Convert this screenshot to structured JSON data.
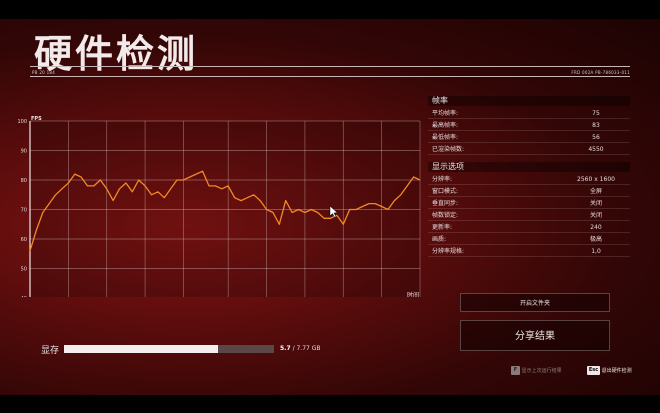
{
  "title": "硬件检测",
  "header": {
    "left_code": "PB 20 184",
    "right_code": "FRD 002A PB-786033-011"
  },
  "chart_data": {
    "type": "line",
    "ylabel": "FPS",
    "xlabel": "时间",
    "ylim": [
      40,
      100
    ],
    "yticks": [
      40,
      50,
      60,
      70,
      80,
      90,
      100
    ],
    "xlim": [
      0,
      61
    ],
    "xticks": [
      0,
      6,
      12,
      18,
      24,
      31,
      37,
      43,
      49,
      55,
      61
    ],
    "xtick_labels": [
      "0s",
      "6s",
      "12s",
      "18s",
      "24s",
      "31s",
      "37s",
      "43s",
      "49s",
      "55s",
      "61s"
    ],
    "grid": true,
    "color": "#f08a24",
    "series": [
      {
        "x": [
          0,
          1,
          2,
          3,
          4,
          5,
          6,
          7,
          8,
          9,
          10,
          11,
          12,
          13,
          14,
          15,
          16,
          17,
          18,
          19,
          20,
          21,
          22,
          23,
          24,
          25,
          26,
          27,
          28,
          29,
          30,
          31,
          32,
          33,
          34,
          35,
          36,
          37,
          38,
          39,
          40,
          41,
          42,
          43,
          44,
          45,
          46,
          47,
          48,
          49,
          50,
          51,
          52,
          53,
          54,
          55,
          56,
          57,
          58,
          59,
          60,
          61
        ],
        "values": [
          56,
          63,
          69,
          72,
          75,
          77,
          79,
          82,
          81,
          78,
          78,
          80,
          77,
          73,
          77,
          79,
          76,
          80,
          78,
          75,
          76,
          74,
          77,
          80,
          80,
          81,
          82,
          83,
          78,
          78,
          77,
          78,
          74,
          73,
          74,
          75,
          73,
          70,
          69,
          65,
          73,
          69,
          70,
          69,
          70,
          69,
          67,
          67,
          68,
          65,
          70,
          70,
          71,
          72,
          72,
          71,
          70,
          73,
          75,
          78,
          81,
          80
        ]
      }
    ]
  },
  "stats": {
    "frame_header": "帧率",
    "rows": [
      {
        "label": "平均帧率:",
        "value": "75"
      },
      {
        "label": "最高帧率:",
        "value": "83"
      },
      {
        "label": "最低帧率:",
        "value": "56"
      },
      {
        "label": "已渲染帧数:",
        "value": "4550"
      }
    ]
  },
  "display": {
    "header": "显示选项",
    "rows": [
      {
        "label": "分辨率:",
        "value": "2560 x 1600"
      },
      {
        "label": "窗口模式:",
        "value": "全屏"
      },
      {
        "label": "垂直同步:",
        "value": "关闭"
      },
      {
        "label": "帧数锁定:",
        "value": "关闭"
      },
      {
        "label": "更新率:",
        "value": "240"
      },
      {
        "label": "画质:",
        "value": "极高"
      },
      {
        "label": "分辨率规格:",
        "value": "1,0"
      }
    ]
  },
  "buttons": {
    "open_folder": "开启文件夹",
    "share": "分享结果"
  },
  "vram": {
    "label": "显存",
    "used": "5.7",
    "total": "/ 7.77 GB",
    "fraction": 0.734
  },
  "hints": {
    "last_key": "F",
    "last_label": "显示上次运行结果",
    "exit_key": "Esc",
    "exit_label": "退出硬件检测"
  }
}
